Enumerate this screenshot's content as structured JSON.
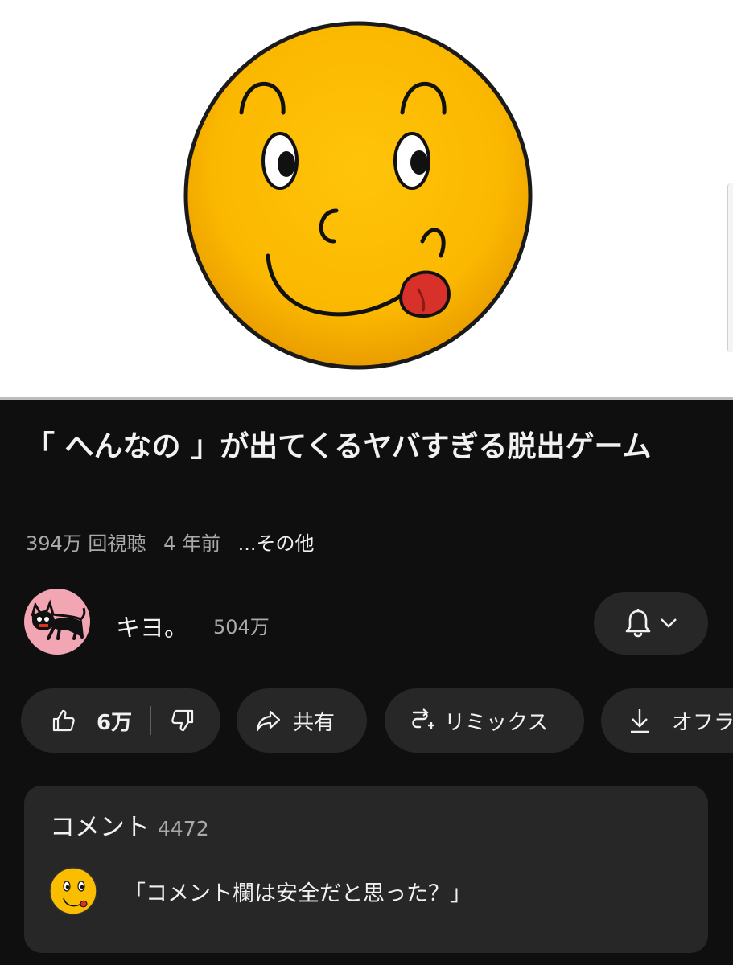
{
  "video": {
    "thumbnail_icon": "tongue-out-face-icon",
    "title": "「 へんなの 」が出てくるヤバすぎる脱出ゲーム",
    "views": "394万 回視聴",
    "age": "4 年前",
    "more": "...その他"
  },
  "channel": {
    "avatar_icon": "black-cat-icon",
    "name": "キヨ。",
    "subscribers": "504万",
    "bell_icon": "bell-icon",
    "chevron_icon": "chevron-down-icon"
  },
  "actions": {
    "likes": "6万",
    "share": "共有",
    "remix": "リミックス",
    "offline": "オフラ"
  },
  "comments": {
    "title": "コメント",
    "count": "4472",
    "top_comment": "「コメント欄は安全だと思った？」"
  },
  "colors": {
    "background": "#0f0f0f",
    "surface": "#272727",
    "text": "#f1f1f1",
    "muted": "#aaaaaa"
  }
}
